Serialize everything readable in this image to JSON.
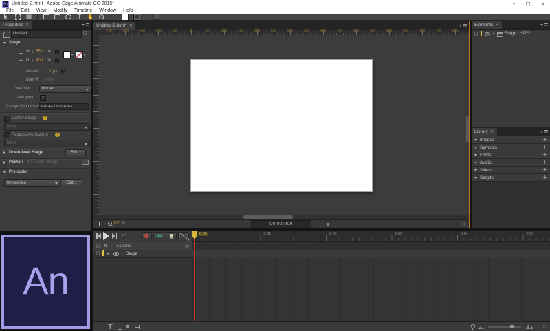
{
  "window": {
    "title": "Untitled-2.html - Adobe Edge Animate CC 2015*",
    "app_icon_text": "An",
    "minimize": "–",
    "maximize": "□",
    "close": "×"
  },
  "menu": {
    "items": [
      "File",
      "Edit",
      "View",
      "Modify",
      "Timeline",
      "Window",
      "Help"
    ]
  },
  "toolbar": {
    "tools": [
      "selection",
      "transform",
      "clipping",
      "rectangle",
      "rounded-rectangle",
      "ellipse",
      "text",
      "hand",
      "zoom"
    ],
    "text_tool_glyph": "T",
    "hand_tool_glyph": "✋"
  },
  "ui": {
    "close": "×",
    "plus": "+",
    "check": "✓",
    "braces": "{}",
    "bullet": "•",
    "help": "?",
    "return_arrow": "↩",
    "pin_arrows": "⇅",
    "target": "◎"
  },
  "properties": {
    "tab_label": "Properties",
    "name_value": "Untitled",
    "stage_section": "Stage",
    "w_label": "W",
    "w_value": "550",
    "h_label": "H",
    "h_value": "400",
    "px_unit": "px",
    "min_w_label": "Min W",
    "min_w_value": "0",
    "max_w_label": "Max W .",
    "max_w_value": "none",
    "overflow_label": "Overflow:",
    "overflow_value": "hidden",
    "autoplay_label": "Autoplay:",
    "composition_label": "Composition Class:",
    "composition_value": "EDGE-226926263",
    "center_stage_label": "Center Stage",
    "center_stage_value": "None",
    "responsive_scaling_label": "Responsive Scaling",
    "responsive_scaling_value": "None",
    "downlevel_label": "Down-level Stage",
    "edit_button": "Edit...",
    "poster_label": "Poster:",
    "poster_value": "No Poster Image",
    "preloader_label": "Preloader",
    "preloader_value": "Immediate",
    "preloader_edit_button": "Edit..."
  },
  "stage": {
    "tab_label": "Untitled-2.html*",
    "ruler_labels": [
      "-250",
      "-200",
      "-150",
      "-100",
      "-50",
      "0",
      "50",
      "100",
      "150",
      "200",
      "250",
      "300",
      "350",
      "400",
      "450",
      "500",
      "550",
      "600",
      "650",
      "700",
      "750",
      "800"
    ],
    "zoom_value": "100",
    "zoom_unit": "%",
    "timecode": "00:00,000"
  },
  "elements": {
    "tab_label": "Elements",
    "rows": [
      {
        "label": "Stage",
        "tag": "<div>"
      }
    ]
  },
  "library": {
    "tab_label": "Library",
    "sections": [
      {
        "label": "Images"
      },
      {
        "label": "Symbols"
      },
      {
        "label": "Fonts"
      },
      {
        "label": "Audio"
      },
      {
        "label": "Video"
      },
      {
        "label": "Scripts"
      }
    ]
  },
  "timeline": {
    "actions_label": "Actions",
    "layers": [
      {
        "label": "Stage"
      }
    ],
    "ruler_labels": [
      "0:00",
      "0:01",
      "0:02",
      "0:03",
      "0:04",
      "0:05"
    ]
  },
  "logo": {
    "text": "An"
  },
  "colors": {
    "focus_border_orange": "#b5791f",
    "value_orange": "#cf9b3f",
    "ruler_text_orange": "#8a6f33",
    "playhead_red": "#c03226",
    "playhead_marker_yellow": "#d8b93c",
    "layer_bar_yellow": "#d8c23e",
    "logo_bg": "#201d47",
    "logo_accent": "#a5a2ec"
  }
}
